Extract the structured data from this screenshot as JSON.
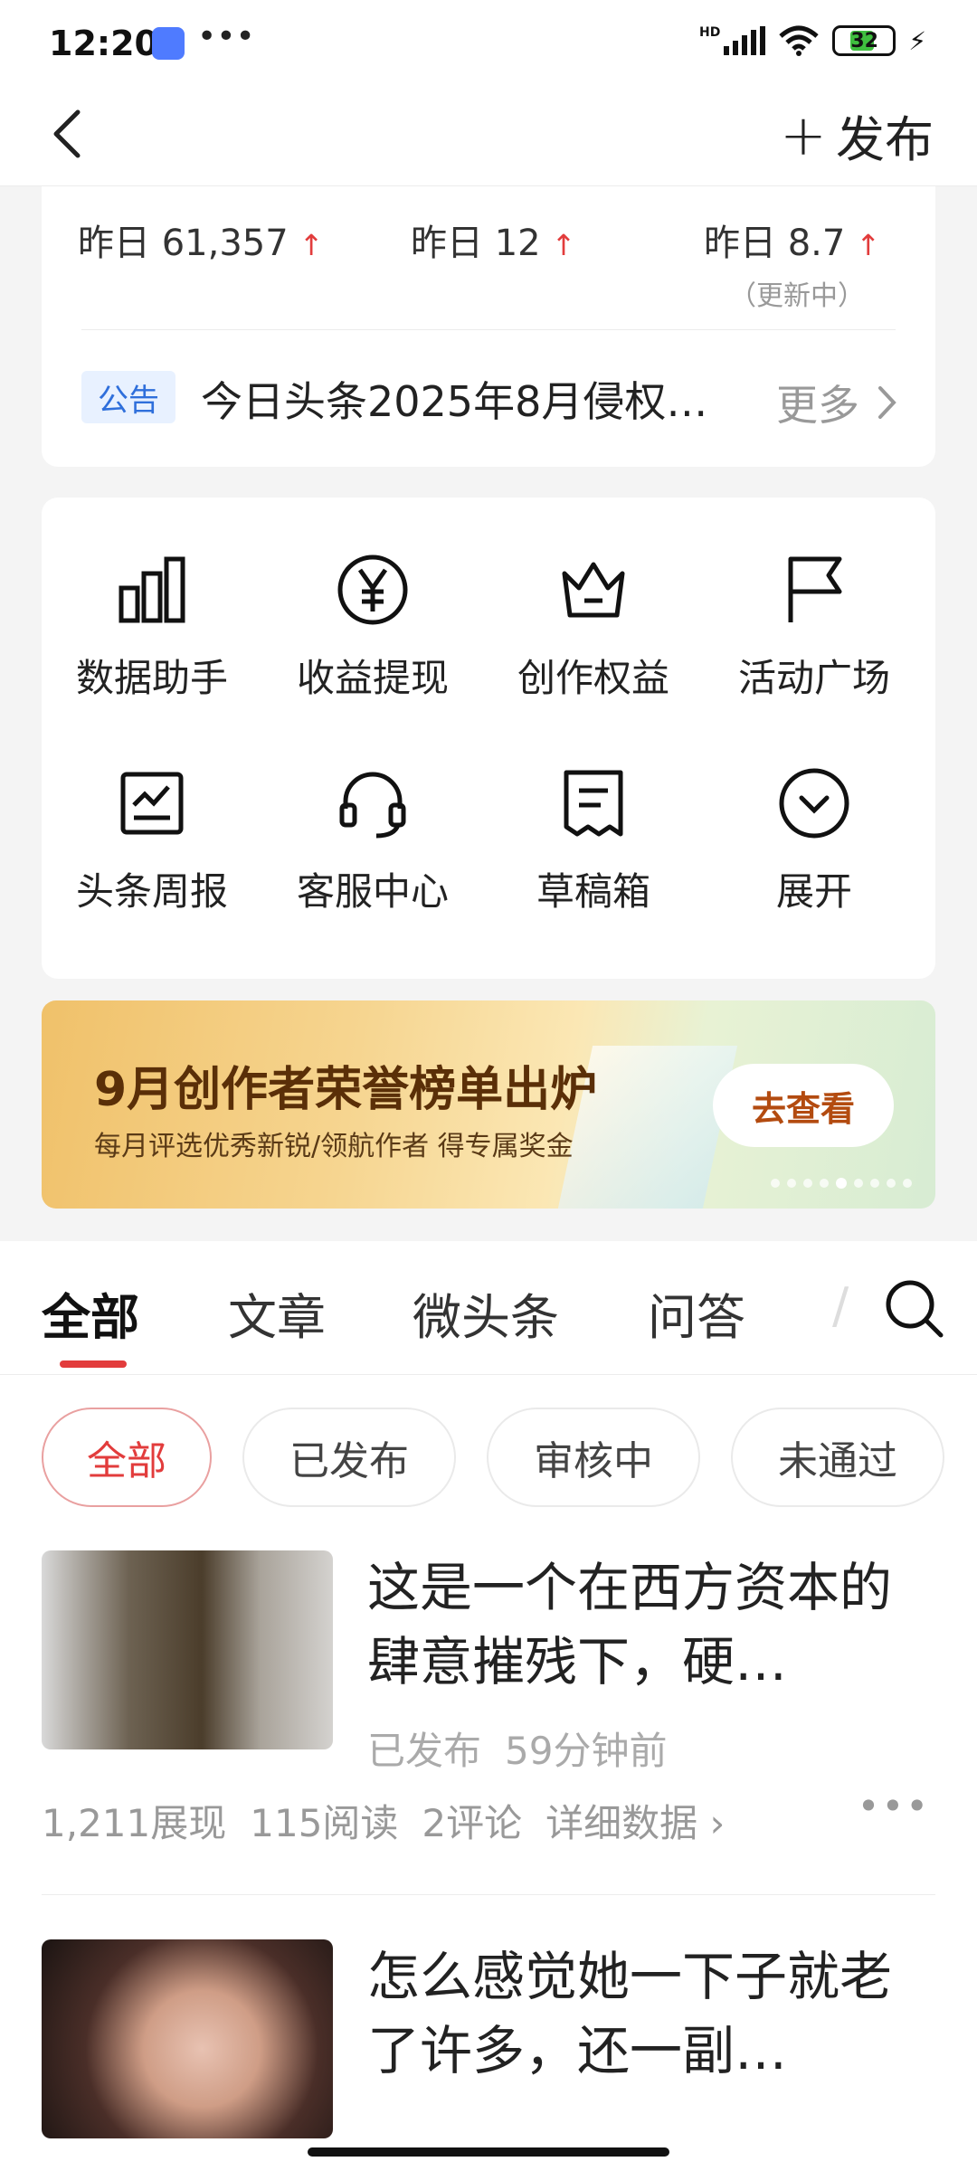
{
  "status_bar": {
    "time": "12:20",
    "dots": "•••",
    "hd": "HD",
    "battery": "32"
  },
  "header": {
    "publish_label": "发布"
  },
  "stats": {
    "items": [
      {
        "label": "昨日 61,357",
        "trend": "↑"
      },
      {
        "label": "昨日 12",
        "trend": "↑"
      },
      {
        "label": "昨日 8.7",
        "trend": "↑"
      }
    ],
    "note": "（更新中）"
  },
  "notice": {
    "tag": "公告",
    "text": "今日头条2025年8月侵权…",
    "more": "更多"
  },
  "tools": [
    {
      "label": "数据助手",
      "icon": "bar-chart-icon"
    },
    {
      "label": "收益提现",
      "icon": "yen-icon"
    },
    {
      "label": "创作权益",
      "icon": "crown-icon"
    },
    {
      "label": "活动广场",
      "icon": "flag-icon"
    },
    {
      "label": "头条周报",
      "icon": "report-icon"
    },
    {
      "label": "客服中心",
      "icon": "headset-icon"
    },
    {
      "label": "草稿箱",
      "icon": "draft-icon"
    },
    {
      "label": "展开",
      "icon": "expand-icon"
    }
  ],
  "banner": {
    "title": "9月创作者荣誉榜单出炉",
    "subtitle": "每月评选优秀新锐/领航作者 得专属奖金",
    "button": "去查看",
    "pages": 9,
    "active_page": 5
  },
  "tabs": [
    "全部",
    "文章",
    "微头条",
    "问答"
  ],
  "active_tab": "全部",
  "tab_fade": "/",
  "filters": [
    "全部",
    "已发布",
    "审核中",
    "未通过"
  ],
  "active_filter": "全部",
  "articles": [
    {
      "title": "这是一个在西方资本的肆意摧残下，硬…",
      "status": "已发布",
      "time": "59分钟前",
      "views": "1,211展现",
      "reads": "115阅读",
      "comments": "2评论",
      "detail": "详细数据 ›",
      "more": "•••"
    },
    {
      "title": "怎么感觉她一下子就老了许多，还一副…"
    }
  ]
}
